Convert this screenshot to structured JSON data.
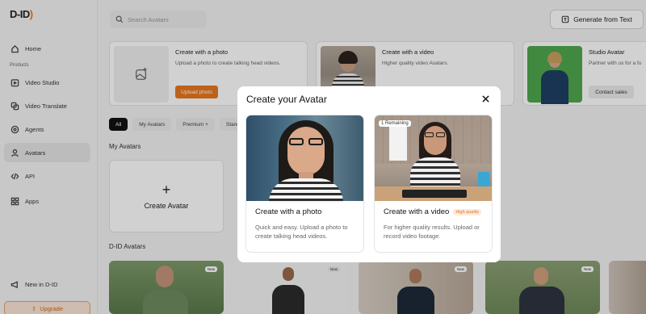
{
  "app": {
    "logo_main": "D-ID",
    "logo_paren": ")"
  },
  "sidebar": {
    "home": "Home",
    "products_label": "Products",
    "items": [
      {
        "label": "Video Studio"
      },
      {
        "label": "Video Translate"
      },
      {
        "label": "Agents"
      },
      {
        "label": "Avatars"
      },
      {
        "label": "API"
      },
      {
        "label": "Apps"
      }
    ],
    "new_in": "New in D-ID",
    "upgrade": "Upgrade"
  },
  "header": {
    "search_placeholder": "Search Avatars",
    "generate_button": "Generate from Text"
  },
  "cards": [
    {
      "title": "Create with a photo",
      "desc": "Upload a photo to create talking head videos.",
      "button": "Upload photo"
    },
    {
      "title": "Create with a video",
      "desc": "Higher quality video Avatars."
    },
    {
      "title": "Studio Avatar",
      "desc": "Partner with us for a fu",
      "button": "Contact sales"
    }
  ],
  "filters": [
    "All",
    "My Avatars",
    "Premium +",
    "Standa"
  ],
  "sections": {
    "my_avatars": "My Avatars",
    "did_avatars": "D-ID Avatars",
    "create_avatar": "Create Avatar",
    "new_badge": "New"
  },
  "modal": {
    "title": "Create your Avatar",
    "options": [
      {
        "title": "Create with a photo",
        "desc": "Quick and easy. Upload a photo to create talking head videos."
      },
      {
        "title": "Create with a video",
        "badge": "High quality",
        "remaining": "1 Remaining",
        "desc": "For higher quality results. Upload or record video footage."
      }
    ]
  },
  "colors": {
    "accent": "#e8781f",
    "active_chip": "#111111"
  }
}
